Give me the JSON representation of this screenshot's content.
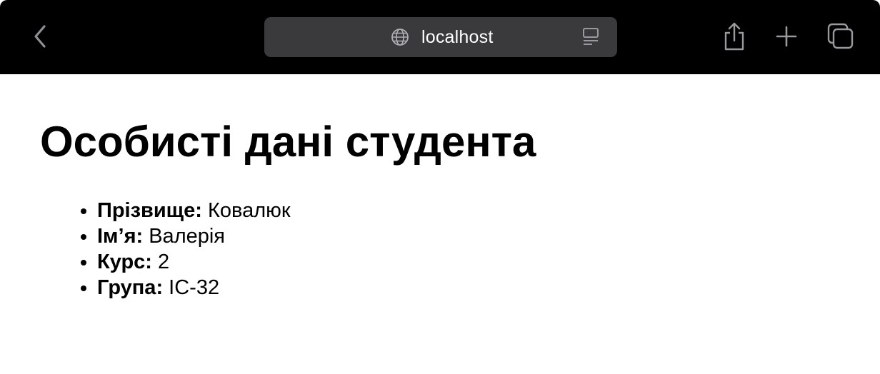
{
  "browser": {
    "address": "localhost",
    "icons": {
      "back": "chevron-left-icon",
      "site": "globe-icon",
      "reader": "reader-mode-icon",
      "share": "share-icon",
      "new_tab": "plus-icon",
      "tabs": "tabs-overview-icon"
    },
    "colors": {
      "toolbar": "#000000",
      "address_bar": "#3a3a3c",
      "icon": "#9a9a9e"
    }
  },
  "page": {
    "title": "Особисті дані студента",
    "items": [
      {
        "label": "Прізвище:",
        "value": "Ковалюк"
      },
      {
        "label": "Ім’я:",
        "value": "Валерія"
      },
      {
        "label": "Курс:",
        "value": "2"
      },
      {
        "label": "Група:",
        "value": "ІС-32"
      }
    ]
  }
}
